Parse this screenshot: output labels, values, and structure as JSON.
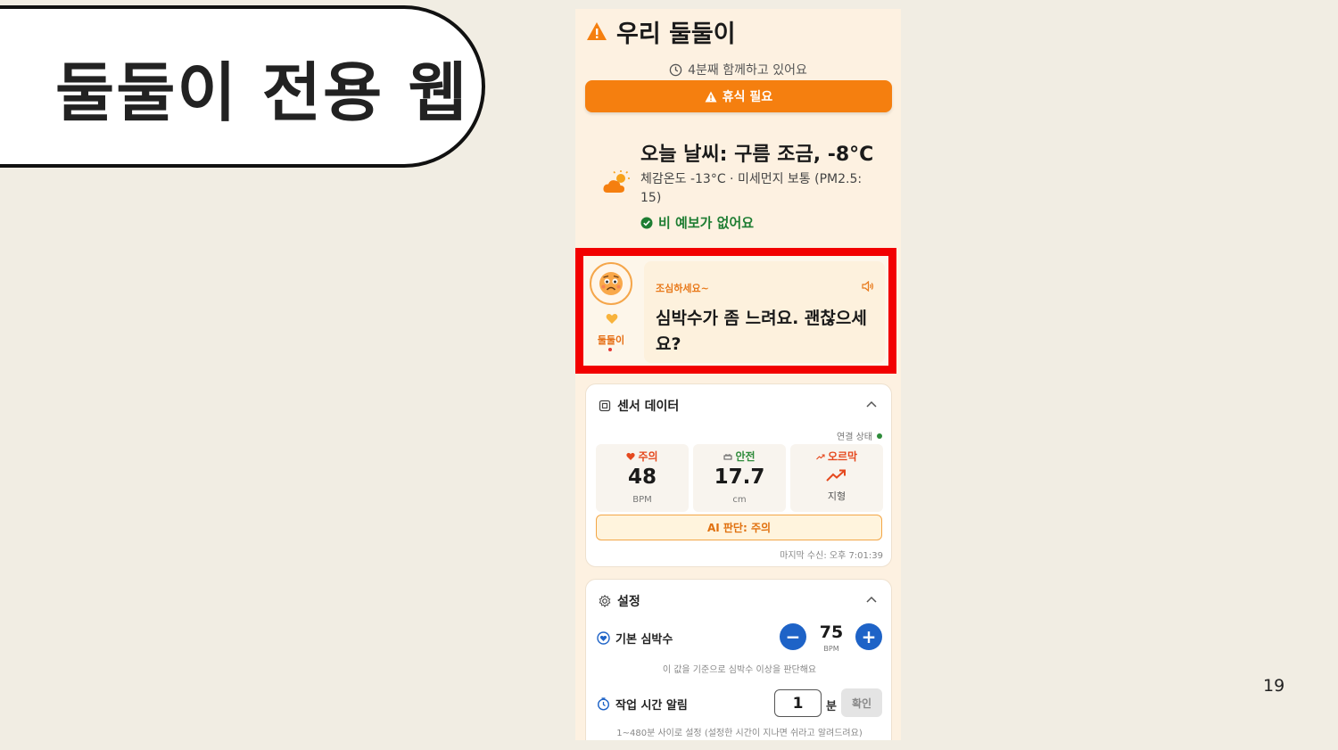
{
  "slide": {
    "title": "둘둘이 전용 웹",
    "page_number": "19"
  },
  "app": {
    "title": "우리 둘둘이",
    "elapsed": "4분째 함께하고 있어요",
    "rest_button": "휴식 필요"
  },
  "weather": {
    "title": "오늘 날씨: 구름 조금, -8°C",
    "detail": "체감온도 -13°C · 미세먼지 보통 (PM2.5: 15)",
    "rain": "비 예보가 없어요"
  },
  "message": {
    "avatar_name": "둘둘이",
    "tag": "조심하세요~",
    "text": "심박수가 좀 느려요. 괜찮으세요?"
  },
  "sensor": {
    "title": "센서 데이터",
    "connection": "연결 상태",
    "metrics": [
      {
        "label": "주의",
        "value": "48",
        "unit": "BPM",
        "color": "#e5491f"
      },
      {
        "label": "안전",
        "value": "17.7",
        "unit": "cm",
        "color": "#2e8b3a"
      },
      {
        "label": "오르막",
        "value": "",
        "unit": "지형",
        "color": "#e5491f"
      }
    ],
    "ai_judgement": "AI 판단: 주의",
    "last_received": "마지막 수신: 오후 7:01:39"
  },
  "settings": {
    "title": "설정",
    "base_hr_label": "기본 심박수",
    "base_hr_value": "75",
    "base_hr_unit": "BPM",
    "minus": "−",
    "plus": "+",
    "base_hr_help": "이 값을 기준으로 심박수 이상을 판단해요",
    "work_alarm_label": "작업 시간 알림",
    "work_alarm_value": "1",
    "work_alarm_unit": "분",
    "confirm": "확인",
    "work_alarm_help": "1~480분 사이로 설정 (설정한 시간이 지나면 쉬라고 알려드려요)"
  },
  "colors": {
    "accent_orange": "#f57f0f",
    "highlight_red": "#f20000",
    "primary_blue": "#1e63c7",
    "app_background": "#fdf1e1",
    "slide_background": "#f1ede3"
  }
}
